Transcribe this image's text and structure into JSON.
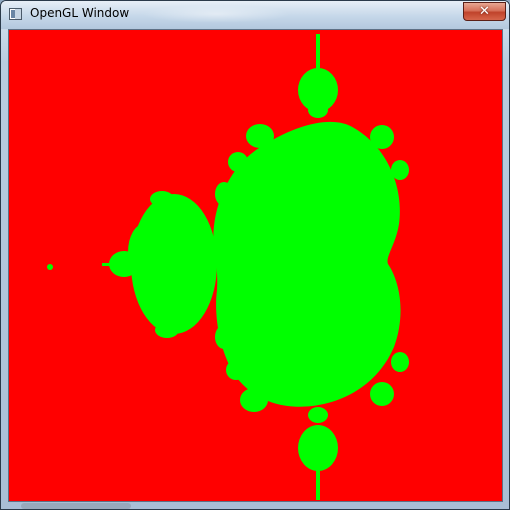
{
  "window": {
    "title": "OpenGL Window",
    "close_label": "✕"
  },
  "canvas": {
    "background_color": "#ff0000",
    "set_color": "#00ff00",
    "content": "mandelbrot-set"
  },
  "colors": {
    "titlebar": "#c5d7e9",
    "close_button": "#c0432b"
  }
}
